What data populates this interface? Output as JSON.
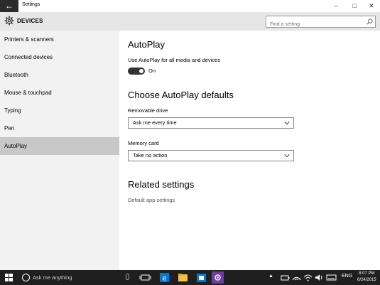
{
  "window": {
    "title": "Settings",
    "back_glyph": "←",
    "controls": {
      "minimize": "–",
      "maximize": "□",
      "close": "✕"
    }
  },
  "header": {
    "section": "DEVICES",
    "icon": "gear-icon",
    "search_placeholder": "Find a setting"
  },
  "sidebar": {
    "items": [
      {
        "label": "Printers & scanners",
        "active": false
      },
      {
        "label": "Connected devices",
        "active": false
      },
      {
        "label": "Bluetooth",
        "active": false
      },
      {
        "label": "Mouse & touchpad",
        "active": false
      },
      {
        "label": "Typing",
        "active": false
      },
      {
        "label": "Pen",
        "active": false
      },
      {
        "label": "AutoPlay",
        "active": true
      }
    ],
    "active_color": "#c8c8c8"
  },
  "main": {
    "autoplay_heading": "AutoPlay",
    "autoplay_toggle_label": "Use AutoPlay for all media and devices",
    "autoplay_toggle_state": "On",
    "defaults_heading": "Choose AutoPlay defaults",
    "removable_label": "Removable drive",
    "removable_value": "Ask me every time",
    "memory_label": "Memory card",
    "memory_value": "Take no action",
    "related_heading": "Related settings",
    "related_link": "Default app settings"
  },
  "taskbar": {
    "search_text": "Ask me anything",
    "language": "ENG",
    "time": "8:07 PM",
    "date": "6/24/2015",
    "accent": "#0078d7"
  }
}
